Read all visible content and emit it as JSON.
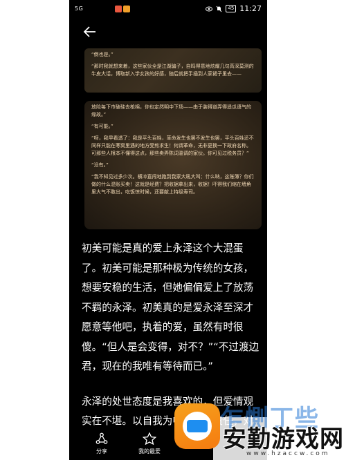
{
  "status_bar": {
    "signal": "5G",
    "battery": "45",
    "time": "11:27"
  },
  "photo": {
    "top_paragraphs": [
      "“倒也是。”",
      "“那时我就想来着，这些家伙全是江湖骗子，自鸣得意地炫耀几句高深莫测的牛皮大话，博取新入学女孩的好感，随后就把手插到人家裙子里去——"
    ],
    "paragraphs": [
      "放险每下市破硅去枪棉，你也定然明中下场——由于装得道弄得遥瓜语气的缘故。”",
      "“有可能。”",
      "“呀，我早看透了：我是平头百姓，革命发生也罢不发生也罢，平头百姓还不同样只能在寒窝里遇的地方受煎求生！何谓革命，无非更换一下政府名称。可那些人根本不懂得这点，那些卖弄陈词滥调的家伙。你可见过税务员？”",
      "“没有。”",
      "“我不知见过多少次。横冲直闯地跑到我家大吼大叫：什么呐，这账簿？你们做的什么混账买卖！这就是经费？把收据拿出来，收据！吓得我们缩在墙角里大气不敢出，吃饭惊时候，还要献上特级寿司。"
    ]
  },
  "article": {
    "paragraphs": [
      "初美可能是真的爱上永泽这个大混蛋了。初美可能是那种极为传统的女孩，想要安稳的生活，但她偏偏爱上了放荡不羁的永泽。初美真的是爱永泽至深才愿意等他吧，执着的爱，虽然有时很傻。“但人是会变得，对不？”“不过渡边君，现在的我唯有等待而已。”",
      "永泽的处世态度是我喜欢的，但爱情观实在不堪。以自我为中心，负责任，对于发展自"
    ]
  },
  "bottom_bar": {
    "share_label": "分享",
    "favorite_label": "我的最爱"
  },
  "watermark": {
    "ghost_text": "乍惻丁些",
    "title": "安勤游戏网",
    "url": "www.hzaccw.com"
  },
  "colors": {
    "app_background": "#000000",
    "photo_text": "#f1d9b6",
    "watermark_orange": "#f57b10",
    "watermark_blue": "#1e8ef0"
  }
}
